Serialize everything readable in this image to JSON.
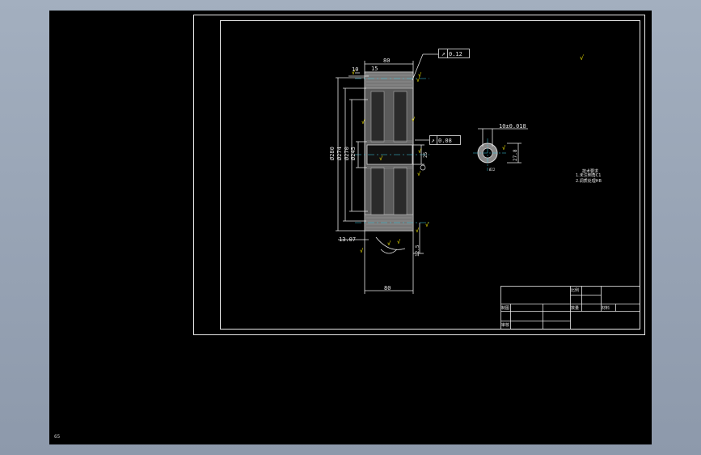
{
  "dims": {
    "top_width": "80",
    "top_small": "10",
    "top_small2": "15",
    "left_overall": "Ø280",
    "left_2": "Ø274",
    "left_3": "Ø270",
    "left_4": "Ø245",
    "bottom_left": "13.07",
    "bottom_width": "80",
    "bore": "Ø22",
    "keyway_width": "10±0.018",
    "keyway_depth": "27.8",
    "right_small": "12.5"
  },
  "tolerances": {
    "runout_top": "0.12",
    "runout_mid": "0.08"
  },
  "notes": {
    "title": "技术要求",
    "line1": "1.未注倒角C1",
    "line2": "2.调质处理HB"
  },
  "title_block": {
    "r1c1": "比例",
    "r2c1": "数量",
    "r2c2": "材料",
    "r3c1": "制图",
    "r4c1": "审核"
  },
  "status": {
    "coord": "65"
  }
}
